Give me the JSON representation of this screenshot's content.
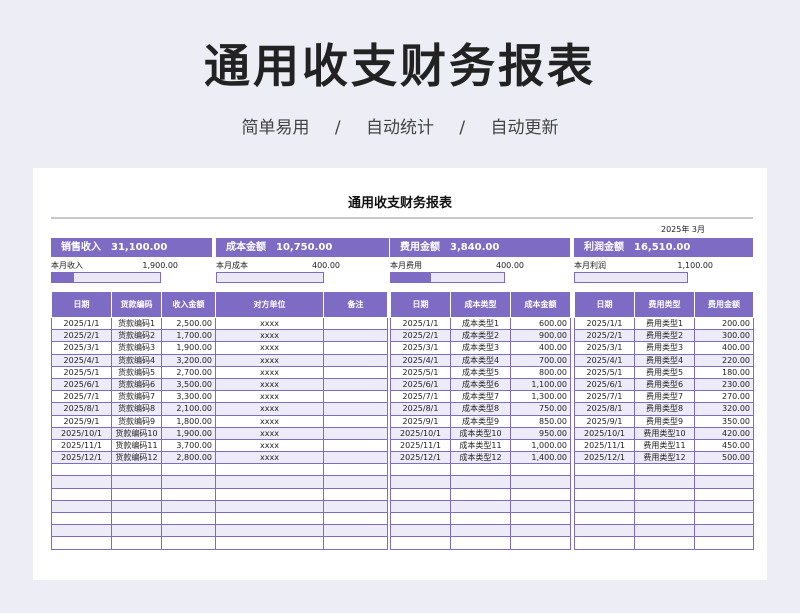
{
  "header": {
    "title": "通用收支财务报表",
    "sub1": "简单易用",
    "sep": "/",
    "sub2": "自动统计",
    "sub3": "自动更新"
  },
  "sheet": {
    "title": "通用收支财务报表",
    "date": "2025年 3月"
  },
  "colors": {
    "accent": "#7e6bc3",
    "alt_row": "#ecebf7"
  },
  "summary": [
    {
      "label": "销售收入",
      "value": "31,100.00",
      "month_label": "本月收入",
      "month_value": "1,900.00",
      "ratio": 0.2
    },
    {
      "label": "成本金额",
      "value": "10,750.00",
      "month_label": "本月成本",
      "month_value": "400.00",
      "ratio": 0.0
    },
    {
      "label": "费用金额",
      "value": "3,840.00",
      "month_label": "本月费用",
      "month_value": "400.00",
      "ratio": 0.35
    },
    {
      "label": "利润金额",
      "value": "16,510.00",
      "month_label": "本月利润",
      "month_value": "1,100.00",
      "ratio": 0.0
    }
  ],
  "sales": {
    "headers": [
      "日期",
      "货款编码",
      "收入金额",
      "对方单位",
      "备注"
    ],
    "rows": [
      [
        "2025/1/1",
        "货款编码1",
        "2,500.00",
        "xxxx",
        ""
      ],
      [
        "2025/2/1",
        "货款编码2",
        "1,700.00",
        "xxxx",
        ""
      ],
      [
        "2025/3/1",
        "货款编码3",
        "1,900.00",
        "xxxx",
        ""
      ],
      [
        "2025/4/1",
        "货款编码4",
        "3,200.00",
        "xxxx",
        ""
      ],
      [
        "2025/5/1",
        "货款编码5",
        "2,700.00",
        "xxxx",
        ""
      ],
      [
        "2025/6/1",
        "货款编码6",
        "3,500.00",
        "xxxx",
        ""
      ],
      [
        "2025/7/1",
        "货款编码7",
        "3,300.00",
        "xxxx",
        ""
      ],
      [
        "2025/8/1",
        "货款编码8",
        "2,100.00",
        "xxxx",
        ""
      ],
      [
        "2025/9/1",
        "货款编码9",
        "1,800.00",
        "xxxx",
        ""
      ],
      [
        "2025/10/1",
        "货款编码10",
        "1,900.00",
        "xxxx",
        ""
      ],
      [
        "2025/11/1",
        "货款编码11",
        "3,700.00",
        "xxxx",
        ""
      ],
      [
        "2025/12/1",
        "货款编码12",
        "2,800.00",
        "xxxx",
        ""
      ]
    ]
  },
  "cost": {
    "headers": [
      "日期",
      "成本类型",
      "成本金额"
    ],
    "rows": [
      [
        "2025/1/1",
        "成本类型1",
        "600.00"
      ],
      [
        "2025/2/1",
        "成本类型2",
        "900.00"
      ],
      [
        "2025/3/1",
        "成本类型3",
        "400.00"
      ],
      [
        "2025/4/1",
        "成本类型4",
        "700.00"
      ],
      [
        "2025/5/1",
        "成本类型5",
        "800.00"
      ],
      [
        "2025/6/1",
        "成本类型6",
        "1,100.00"
      ],
      [
        "2025/7/1",
        "成本类型7",
        "1,300.00"
      ],
      [
        "2025/8/1",
        "成本类型8",
        "750.00"
      ],
      [
        "2025/9/1",
        "成本类型9",
        "850.00"
      ],
      [
        "2025/10/1",
        "成本类型10",
        "950.00"
      ],
      [
        "2025/11/1",
        "成本类型11",
        "1,000.00"
      ],
      [
        "2025/12/1",
        "成本类型12",
        "1,400.00"
      ]
    ]
  },
  "expense": {
    "headers": [
      "日期",
      "费用类型",
      "费用金额"
    ],
    "rows": [
      [
        "2025/1/1",
        "费用类型1",
        "200.00"
      ],
      [
        "2025/2/1",
        "费用类型2",
        "300.00"
      ],
      [
        "2025/3/1",
        "费用类型3",
        "400.00"
      ],
      [
        "2025/4/1",
        "费用类型4",
        "220.00"
      ],
      [
        "2025/5/1",
        "费用类型5",
        "180.00"
      ],
      [
        "2025/6/1",
        "费用类型6",
        "230.00"
      ],
      [
        "2025/7/1",
        "费用类型7",
        "270.00"
      ],
      [
        "2025/8/1",
        "费用类型8",
        "320.00"
      ],
      [
        "2025/9/1",
        "费用类型9",
        "350.00"
      ],
      [
        "2025/10/1",
        "费用类型10",
        "420.00"
      ],
      [
        "2025/11/1",
        "费用类型11",
        "450.00"
      ],
      [
        "2025/12/1",
        "费用类型12",
        "500.00"
      ]
    ]
  }
}
